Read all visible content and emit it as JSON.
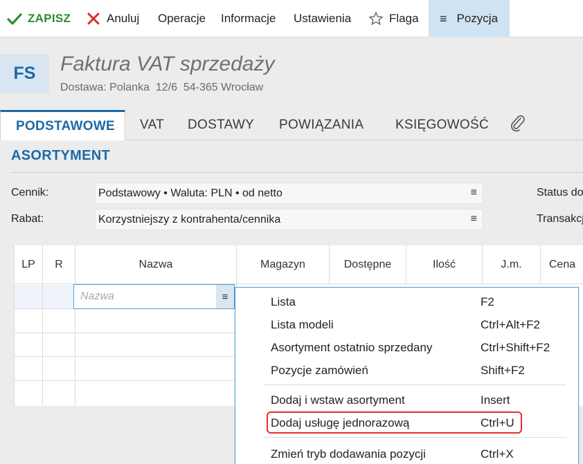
{
  "toolbar": {
    "save_label": "ZAPISZ",
    "cancel_label": "Anuluj",
    "operations_label": "Operacje",
    "info_label": "Informacje",
    "settings_label": "Ustawienia",
    "flag_label": "Flaga",
    "position_label": "Pozycja",
    "menu_glyph": "≡"
  },
  "colors": {
    "accent": "#1b6aa8",
    "save_green": "#2e8b2e",
    "cancel_red": "#d9302c",
    "active_toolbar_bg": "#cfe3f3",
    "highlight_red": "#e0302f"
  },
  "header": {
    "badge": "FS",
    "title": "Faktura VAT sprzedaży",
    "subtitle": "Dostawa: Polanka  12/6  54-365 Wrocław"
  },
  "tabs": [
    {
      "label": "PODSTAWOWE",
      "active": true
    },
    {
      "label": "VAT",
      "active": false
    },
    {
      "label": "DOSTAWY",
      "active": false
    },
    {
      "label": "POWIĄZANIA",
      "active": false
    },
    {
      "label": "KSIĘGOWOŚĆ",
      "active": false
    }
  ],
  "section": {
    "title": "ASORTYMENT"
  },
  "form": {
    "cennik_label": "Cennik:",
    "cennik_value": "Podstawowy • Waluta: PLN • od netto",
    "rabat_label": "Rabat:",
    "rabat_value": "Korzystniejszy z kontrahenta/cennika",
    "right_label_1": "Status do",
    "right_label_2": "Transakcj"
  },
  "grid": {
    "columns": [
      "LP",
      "R",
      "Nazwa",
      "Magazyn",
      "Dostępne",
      "Ilość",
      "J.m.",
      "Cena"
    ],
    "name_placeholder": "Nazwa"
  },
  "dropdown": {
    "items": [
      {
        "label": "Lista",
        "shortcut": "F2"
      },
      {
        "label": "Lista modeli",
        "shortcut": "Ctrl+Alt+F2"
      },
      {
        "label": "Asortyment ostatnio sprzedany",
        "shortcut": "Ctrl+Shift+F2"
      },
      {
        "label": "Pozycje zamówień",
        "shortcut": "Shift+F2"
      },
      {
        "label": "Dodaj i wstaw asortyment",
        "shortcut": "Insert"
      },
      {
        "label": "Dodaj usługę jednorazową",
        "shortcut": "Ctrl+U"
      },
      {
        "label": "Zmień tryb dodawania pozycji",
        "shortcut": "Ctrl+X"
      }
    ]
  }
}
